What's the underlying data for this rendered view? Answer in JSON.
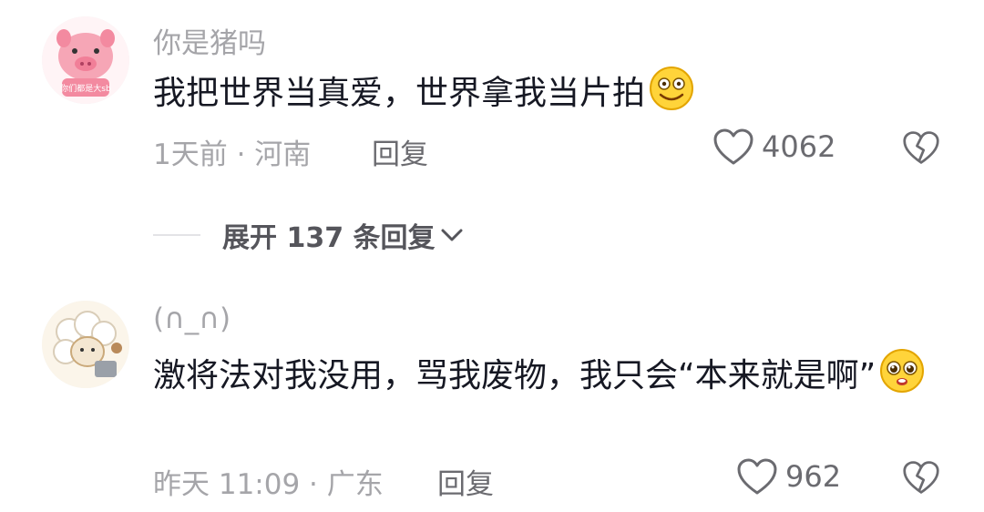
{
  "comments": [
    {
      "username": "你是猪吗",
      "content": "我把世界当真爱，世界拿我当片拍",
      "emoji": "smile-emoji",
      "meta": "1天前 · 河南",
      "reply_label": "回复",
      "likes": "4062",
      "avatar_text": "你们都是大sb"
    },
    {
      "username": "(∩_∩)",
      "content": "激将法对我没用，骂我废物，我只会“本来就是啊”",
      "emoji": "pleading-emoji",
      "meta": "昨天 11:09 · 广东",
      "reply_label": "回复",
      "likes": "962"
    }
  ],
  "expand": {
    "label": "展开 137 条回复"
  },
  "colors": {
    "text_primary": "#161823",
    "text_secondary": "#a5a5a9",
    "action": "#6b6b70"
  }
}
